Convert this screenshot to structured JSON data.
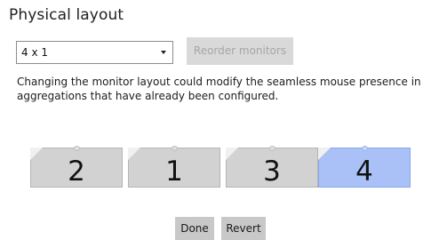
{
  "section": {
    "title": "Physical layout"
  },
  "layout_select": {
    "selected": "4 x 1",
    "icon": "chevron-down-icon"
  },
  "toolbar": {
    "reorder_label": "Reorder monitors"
  },
  "warning_text": "Changing the monitor layout could modify the seamless mouse presence in aggregations that have already been configured.",
  "monitors": [
    {
      "label": "2",
      "selected": false
    },
    {
      "label": "1",
      "selected": false
    },
    {
      "label": "3",
      "selected": false
    },
    {
      "label": "4",
      "selected": true
    }
  ],
  "actions": {
    "done_label": "Done",
    "revert_label": "Revert"
  },
  "colors": {
    "monitor_default": "#d2d2d2",
    "monitor_selected": "#a9c1f7",
    "button_bg": "#c8c8c8",
    "disabled_button_bg": "#d9d9d9",
    "disabled_text": "#a6a6a6"
  }
}
